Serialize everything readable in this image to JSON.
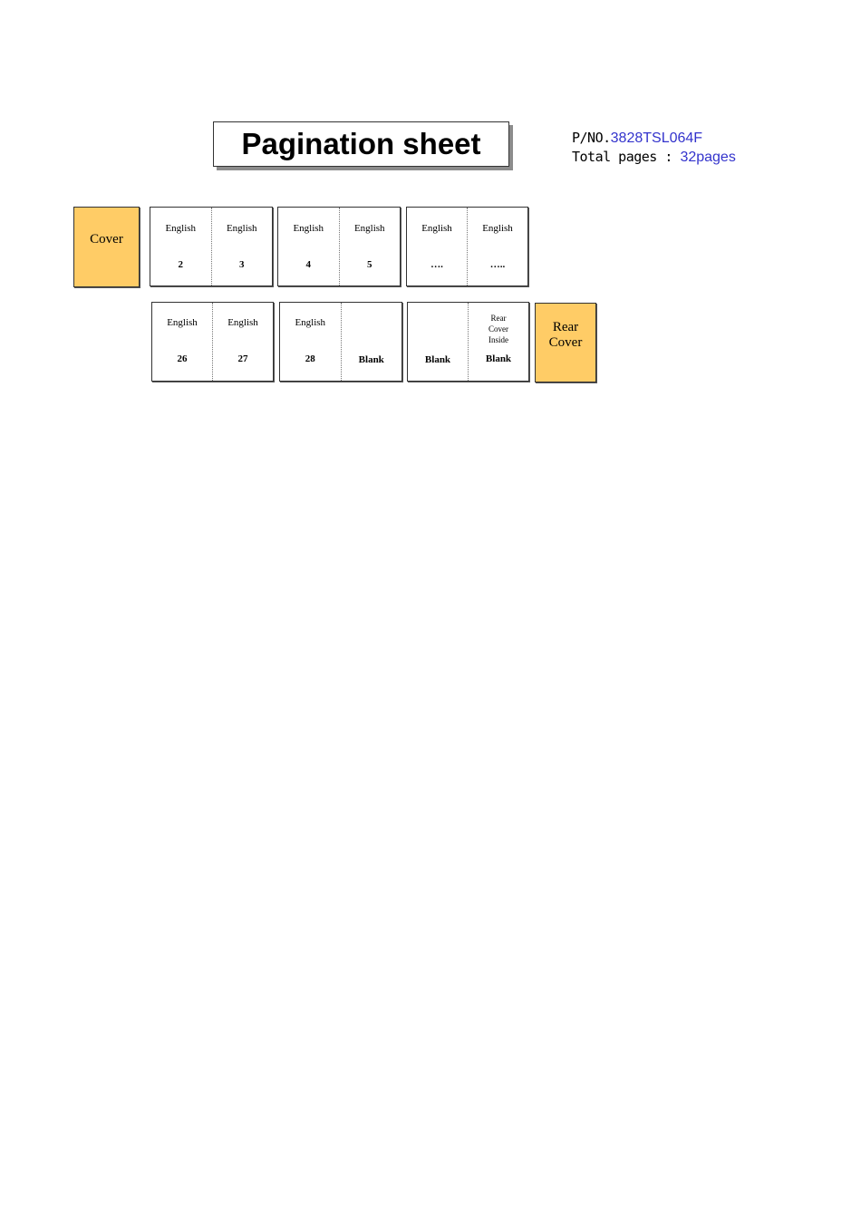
{
  "header": {
    "title": "Pagination sheet",
    "part_number_label": "P/NO.",
    "part_number_value": "3828TSL064F",
    "total_pages_label": "Total pages : ",
    "total_pages_value": "32pages"
  },
  "covers": {
    "front": "Cover",
    "rear_line1": "Rear",
    "rear_line2": "Cover"
  },
  "row1": [
    {
      "left": {
        "lang": "English",
        "num": "2"
      },
      "right": {
        "lang": "English",
        "num": "3"
      }
    },
    {
      "left": {
        "lang": "English",
        "num": "4"
      },
      "right": {
        "lang": "English",
        "num": "5"
      }
    },
    {
      "left": {
        "lang": "English",
        "num": "…."
      },
      "right": {
        "lang": "English",
        "num": "….."
      }
    }
  ],
  "row2": [
    {
      "left": {
        "lang": "English",
        "num": "26"
      },
      "right": {
        "lang": "English",
        "num": "27"
      }
    },
    {
      "left": {
        "lang": "English",
        "num": "28"
      },
      "right": {
        "lang": "",
        "num": "Blank"
      }
    },
    {
      "left": {
        "lang": "",
        "num": "Blank"
      },
      "right": {
        "note_line1": "Rear",
        "note_line2": "Cover",
        "note_line3": "Inside",
        "num": "Blank"
      }
    }
  ],
  "colors": {
    "cover_fill": "#ffcc66",
    "value_text": "#3333cc"
  }
}
